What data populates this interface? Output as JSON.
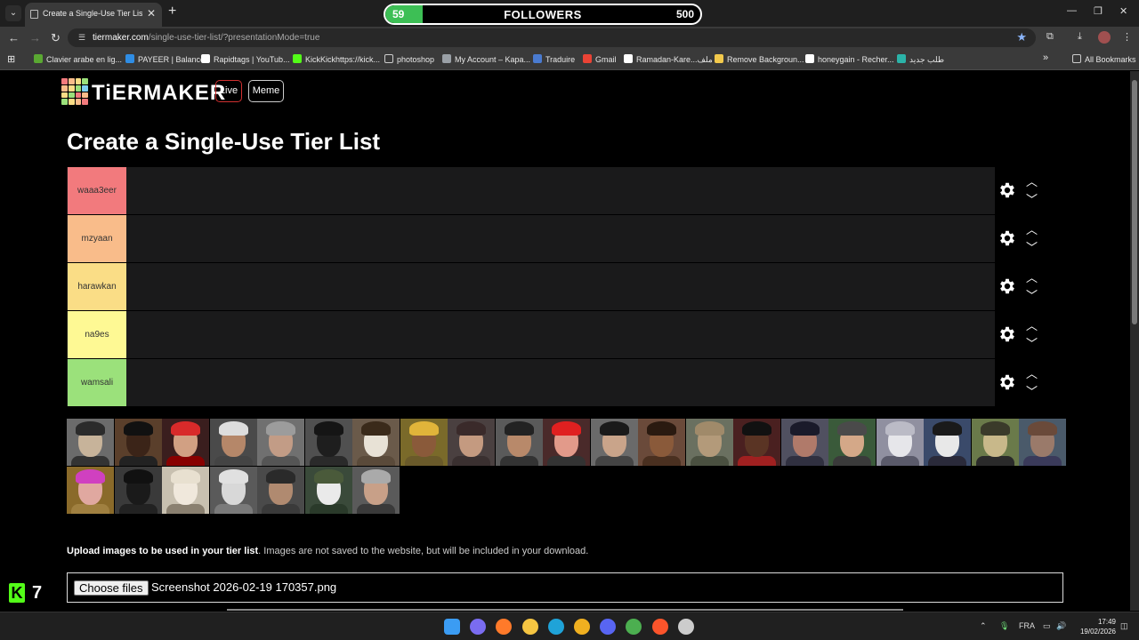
{
  "browser": {
    "tab_title": "Create a Single-Use Tier List (P",
    "url_host": "tiermaker.com",
    "url_path": "/single-use-tier-list/?presentationMode=true",
    "bookmarks": [
      {
        "label": "Clavier arabe en lig...",
        "icon_color": "#5aa832"
      },
      {
        "label": "PAYEER | Balance",
        "icon_color": "#2f8de4"
      },
      {
        "label": "Rapidtags | YouTub...",
        "icon_color": "#ffffff"
      },
      {
        "label": "KickKickhttps://kick...",
        "icon_color": "#53fc18"
      },
      {
        "label": "photoshop",
        "icon_color": "folder"
      },
      {
        "label": "My Account – Kapa...",
        "icon_color": "#9aa0a6"
      },
      {
        "label": "Traduire",
        "icon_color": "#4a7bd0"
      },
      {
        "label": "Gmail",
        "icon_color": "#ea4335"
      },
      {
        "label": "Ramadan-Kare...ملف",
        "icon_color": "#ffffff"
      },
      {
        "label": "Remove Backgroun...",
        "icon_color": "#f2c94c"
      },
      {
        "label": "honeygain - Recher...",
        "icon_color": "#ffffff"
      },
      {
        "label": "طلب جديد",
        "icon_color": "#2bb3a8"
      }
    ],
    "all_bookmarks": "All Bookmarks"
  },
  "followers_widget": {
    "current": 59,
    "goal": 500,
    "label": "FOLLOWERS",
    "fill_color": "#3dbf55"
  },
  "site": {
    "logo_text": "TiERMAKER",
    "live_label": "Live",
    "meme_label": "Meme",
    "page_title": "Create a Single-Use Tier List"
  },
  "tiers": [
    {
      "label": "waaa3eer",
      "color": "#f27a7d"
    },
    {
      "label": "mzyaan",
      "color": "#f9bc8a"
    },
    {
      "label": "harawkan",
      "color": "#fadd86"
    },
    {
      "label": "na9es",
      "color": "#fef994"
    },
    {
      "label": "wamsali",
      "color": "#9be17b"
    }
  ],
  "image_bank": [
    {
      "name": "char-1",
      "bg": "#6b6b6b",
      "skin": "#c7b39a",
      "hair": "#2b2b2b",
      "body": "#333"
    },
    {
      "name": "char-2",
      "bg": "#5a3f2b",
      "skin": "#3b2418",
      "hair": "#111",
      "body": "#222"
    },
    {
      "name": "char-3",
      "bg": "#3a1e1e",
      "skin": "#d1a083",
      "hair": "#d82a2a",
      "body": "#800"
    },
    {
      "name": "char-4",
      "bg": "#4a4a4a",
      "skin": "#b58769",
      "hair": "#ddd",
      "body": "#444"
    },
    {
      "name": "char-5",
      "bg": "#707070",
      "skin": "#c29c86",
      "hair": "#9c9c9c",
      "body": "#555"
    },
    {
      "name": "char-6",
      "bg": "#505050",
      "skin": "#1e1e1e",
      "hair": "#151515",
      "body": "#2a2a2a"
    },
    {
      "name": "char-7",
      "bg": "#6a5a4a",
      "skin": "#e8e2d6",
      "hair": "#3a2a1a",
      "body": "#5a4a3a"
    },
    {
      "name": "char-8",
      "bg": "#7a6a2a",
      "skin": "#8a5a3a",
      "hair": "#e0b43a",
      "body": "#6a5a2a"
    },
    {
      "name": "char-9",
      "bg": "#4a4040",
      "skin": "#c49a80",
      "hair": "#3a2a2a",
      "body": "#3a3030"
    },
    {
      "name": "char-10",
      "bg": "#5a5a5a",
      "skin": "#b8896a",
      "hair": "#222",
      "body": "#333"
    },
    {
      "name": "char-11",
      "bg": "#4a2a2a",
      "skin": "#e29a8a",
      "hair": "#e02020",
      "body": "#333"
    },
    {
      "name": "char-12",
      "bg": "#6a6a6a",
      "skin": "#c9a48a",
      "hair": "#1a1a1a",
      "body": "#444"
    },
    {
      "name": "char-13",
      "bg": "#6a4a3a",
      "skin": "#8a5a3a",
      "hair": "#2a1a10",
      "body": "#4a3020"
    },
    {
      "name": "char-14",
      "bg": "#6a7060",
      "skin": "#b39a7a",
      "hair": "#a08a6a",
      "body": "#4a5040"
    },
    {
      "name": "char-15",
      "bg": "#4a2020",
      "skin": "#5a3424",
      "hair": "#111",
      "body": "#a02020"
    },
    {
      "name": "char-16",
      "bg": "#505060",
      "skin": "#b07a6a",
      "hair": "#1a1a2a",
      "body": "#303040"
    },
    {
      "name": "char-17",
      "bg": "#3a5a3a",
      "skin": "#d4a888",
      "hair": "#4a4a4a",
      "body": "#3a3a3a"
    },
    {
      "name": "char-18",
      "bg": "#9090a0",
      "skin": "#e6e6ea",
      "hair": "#bbbbc6",
      "body": "#5a5a6a"
    },
    {
      "name": "char-19",
      "bg": "#3a4a6a",
      "skin": "#e8e8e8",
      "hair": "#1a1a1a",
      "body": "#2a2a3a"
    },
    {
      "name": "char-20",
      "bg": "#6a7a4a",
      "skin": "#c8b88a",
      "hair": "#3a3a2a",
      "body": "#2a2a2a"
    },
    {
      "name": "char-21",
      "bg": "#4a5a6a",
      "skin": "#9a7a6a",
      "hair": "#6a4a3a",
      "body": "#3a3a5a"
    },
    {
      "name": "char-22",
      "bg": "#8a6a2a",
      "skin": "#e0a8a0",
      "hair": "#d040c0",
      "body": "#a08040"
    },
    {
      "name": "char-23",
      "bg": "#3a3a3a",
      "skin": "#1a1a1a",
      "hair": "#111",
      "body": "#222"
    },
    {
      "name": "char-24",
      "bg": "#c8c0b0",
      "skin": "#f0e8dc",
      "hair": "#e8e0d0",
      "body": "#8a8070"
    },
    {
      "name": "char-25",
      "bg": "#5a5a5a",
      "skin": "#d8d8d8",
      "hair": "#e0e0e0",
      "body": "#7a7a7a"
    },
    {
      "name": "char-26",
      "bg": "#4a4a4a",
      "skin": "#b08a70",
      "hair": "#2a2a2a",
      "body": "#3a3a3a"
    },
    {
      "name": "char-27",
      "bg": "#3a4a3a",
      "skin": "#eaeaea",
      "hair": "#4a5a3a",
      "body": "#2a3a2a"
    },
    {
      "name": "char-28",
      "bg": "#5a5a5a",
      "skin": "#c8a088",
      "hair": "#aaaaaa",
      "body": "#3a3a3a"
    }
  ],
  "upload": {
    "note_bold": "Upload images to be used in your tier list",
    "note_rest": ". Images are not saved to the website, but will be included in your download.",
    "button_label": "Choose files",
    "file_name": "Screenshot 2026-02-19 170357.png"
  },
  "kick_overlay": {
    "logo_letter": "K",
    "count": "7"
  },
  "taskbar": {
    "language": "FRA",
    "time": "17:49",
    "date": "19/02/2026",
    "icons": [
      {
        "name": "windows-start-icon",
        "color": "#3b9cf3"
      },
      {
        "name": "copilot-icon",
        "color": "#7a6cf0"
      },
      {
        "name": "firefox-icon",
        "color": "#ff7a2a"
      },
      {
        "name": "file-explorer-icon",
        "color": "#f5c542"
      },
      {
        "name": "edge-icon",
        "color": "#1fa3d8"
      },
      {
        "name": "opera-gx-icon",
        "color": "#f0b020"
      },
      {
        "name": "discord-icon",
        "color": "#5865f2"
      },
      {
        "name": "chrome-icon",
        "color": "#4caf50"
      },
      {
        "name": "brave-icon",
        "color": "#fb542b"
      },
      {
        "name": "obs-icon",
        "color": "#cccccc"
      }
    ]
  }
}
